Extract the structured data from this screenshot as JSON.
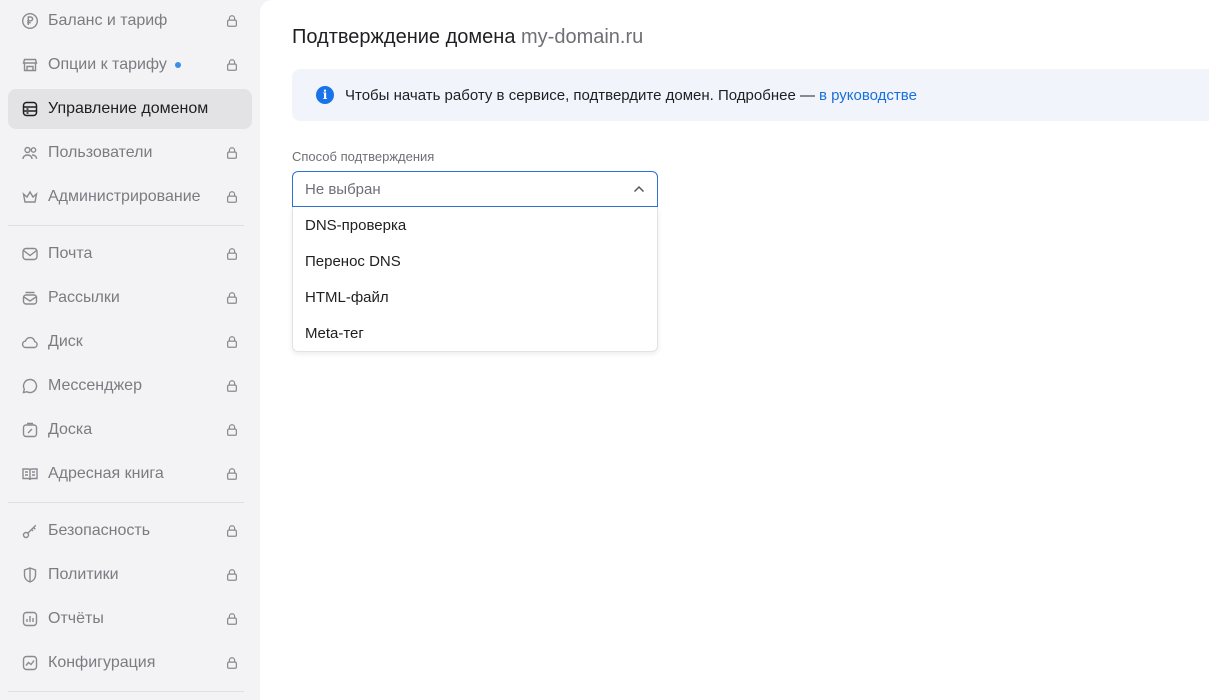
{
  "sidebar": {
    "items": [
      {
        "label": "Баланс и тариф",
        "icon": "ruble-icon",
        "locked": true
      },
      {
        "label": "Опции к тарифу",
        "icon": "shop-icon",
        "locked": true,
        "dot": true
      },
      {
        "label": "Управление доменом",
        "icon": "domain-icon",
        "locked": false,
        "active": true
      },
      {
        "label": "Пользователи",
        "icon": "users-icon",
        "locked": true
      },
      {
        "label": "Администрирование",
        "icon": "crown-icon",
        "locked": true
      },
      {
        "label": "Почта",
        "icon": "mail-icon",
        "locked": true
      },
      {
        "label": "Рассылки",
        "icon": "newsletter-icon",
        "locked": true
      },
      {
        "label": "Диск",
        "icon": "cloud-icon",
        "locked": true
      },
      {
        "label": "Мессенджер",
        "icon": "chat-icon",
        "locked": true
      },
      {
        "label": "Доска",
        "icon": "board-icon",
        "locked": true
      },
      {
        "label": "Адресная книга",
        "icon": "address-book-icon",
        "locked": true
      },
      {
        "label": "Безопасность",
        "icon": "key-icon",
        "locked": true
      },
      {
        "label": "Политики",
        "icon": "shield-icon",
        "locked": true
      },
      {
        "label": "Отчёты",
        "icon": "report-icon",
        "locked": true
      },
      {
        "label": "Конфигурация",
        "icon": "config-icon",
        "locked": true
      }
    ]
  },
  "page": {
    "title": "Подтверждение домена",
    "domain": "my-domain.ru"
  },
  "banner": {
    "text": "Чтобы начать работу в сервисе, подтвердите домен. Подробнее —",
    "link": "в руководстве"
  },
  "form": {
    "label": "Способ подтверждения",
    "placeholder": "Не выбран",
    "options": [
      "DNS-проверка",
      "Перенос DNS",
      "HTML-файл",
      "Meta-тег"
    ]
  },
  "colors": {
    "accent": "#1a73e8",
    "active_bg": "#e3e3e6",
    "banner_bg": "#f1f5fb"
  }
}
